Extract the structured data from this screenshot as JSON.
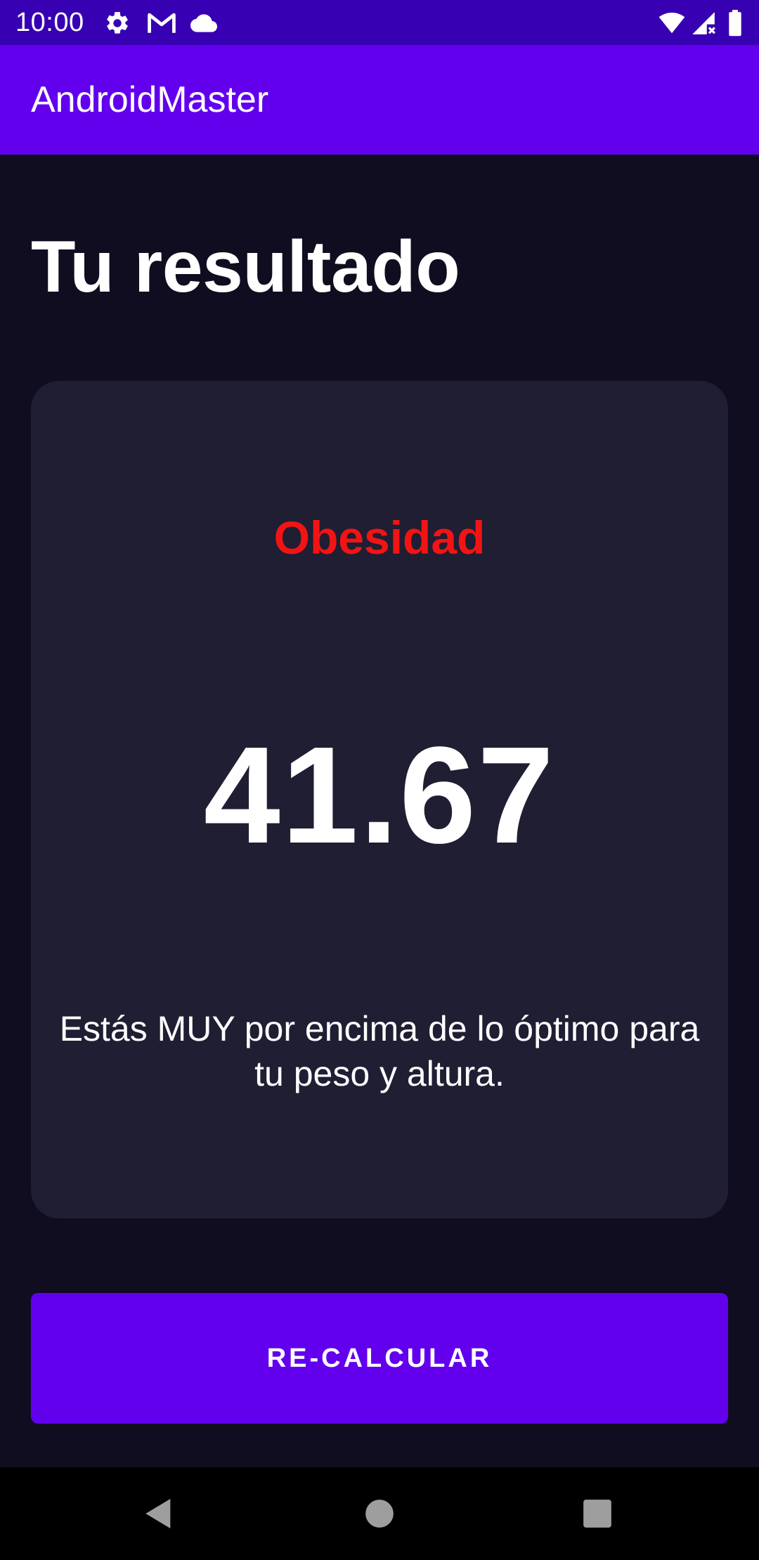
{
  "status_bar": {
    "time": "10:00",
    "icons": [
      "settings-icon",
      "gmail-icon",
      "cloud-icon",
      "wifi-icon",
      "signal-icon",
      "battery-icon"
    ]
  },
  "app_bar": {
    "title": "AndroidMaster",
    "background": "#6200ee"
  },
  "main": {
    "title": "Tu resultado",
    "result": {
      "category": "Obesidad",
      "category_color": "#f21414",
      "value": "41.67",
      "description": "Estás MUY por encima de lo óptimo para tu peso y altura."
    },
    "recalculate_label": "RE-CALCULAR"
  },
  "navigation_bar": {
    "buttons": [
      "back-icon",
      "home-icon",
      "recents-icon"
    ]
  },
  "colors": {
    "background": "#0f0d1f",
    "card": "#1f1e33",
    "status_bar": "#3700b3",
    "accent": "#6200ee"
  }
}
